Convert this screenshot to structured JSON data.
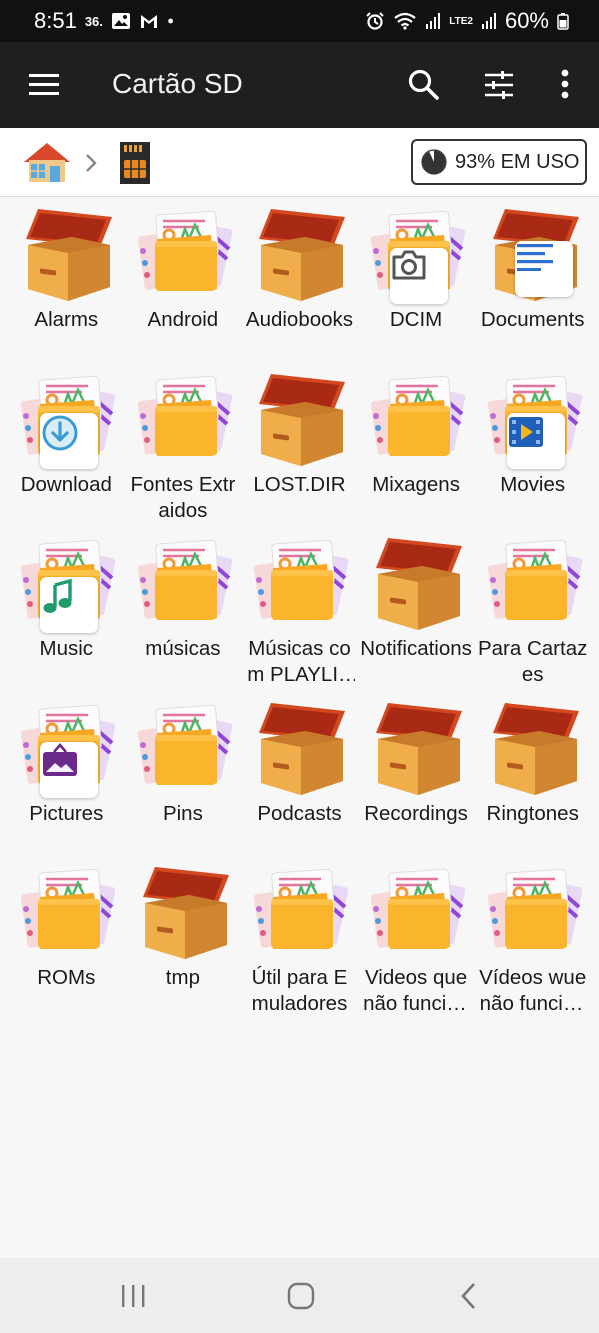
{
  "status_bar": {
    "time": "8:51",
    "notif_text": "36.",
    "lte_label": "LTE2",
    "battery": "60%"
  },
  "app_bar": {
    "title": "Cartão SD"
  },
  "breadcrumb": {
    "usage_label": "93% EM USO",
    "usage_fraction": 0.93
  },
  "colors": {
    "app_bar": "#1f1f1f",
    "status_bar": "#111111",
    "folder_yellow": "#fbb22a",
    "box_orange": "#e8a13a",
    "box_lid_red": "#c4361d"
  },
  "folders": [
    {
      "name": "Alarms",
      "kind": "box"
    },
    {
      "name": "Android",
      "kind": "folder"
    },
    {
      "name": "Audiobooks",
      "kind": "box"
    },
    {
      "name": "DCIM",
      "kind": "folder",
      "overlay": "camera-icon"
    },
    {
      "name": "Documents",
      "kind": "box",
      "overlay": "document-icon"
    },
    {
      "name": "Download",
      "kind": "folder",
      "overlay": "download-icon"
    },
    {
      "name": "Fontes Extraidos",
      "kind": "folder"
    },
    {
      "name": "LOST.DIR",
      "kind": "box"
    },
    {
      "name": "Mixagens",
      "kind": "folder"
    },
    {
      "name": "Movies",
      "kind": "folder",
      "overlay": "movie-icon"
    },
    {
      "name": "Music",
      "kind": "folder",
      "overlay": "music-note-icon"
    },
    {
      "name": "músicas",
      "kind": "folder"
    },
    {
      "name": "Músicas com PLAYLISTS",
      "kind": "folder"
    },
    {
      "name": "Notifications",
      "kind": "box"
    },
    {
      "name": "Para Cartazes",
      "kind": "folder"
    },
    {
      "name": "Pictures",
      "kind": "folder",
      "overlay": "picture-icon"
    },
    {
      "name": "Pins",
      "kind": "folder"
    },
    {
      "name": "Podcasts",
      "kind": "box"
    },
    {
      "name": "Recordings",
      "kind": "box"
    },
    {
      "name": "Ringtones",
      "kind": "box"
    },
    {
      "name": "ROMs",
      "kind": "folder"
    },
    {
      "name": "tmp",
      "kind": "box"
    },
    {
      "name": "Útil para Emuladores",
      "kind": "folder"
    },
    {
      "name": "Videos que não funcionam",
      "kind": "folder"
    },
    {
      "name": "Vídeos wue não funcionam",
      "kind": "folder"
    }
  ]
}
